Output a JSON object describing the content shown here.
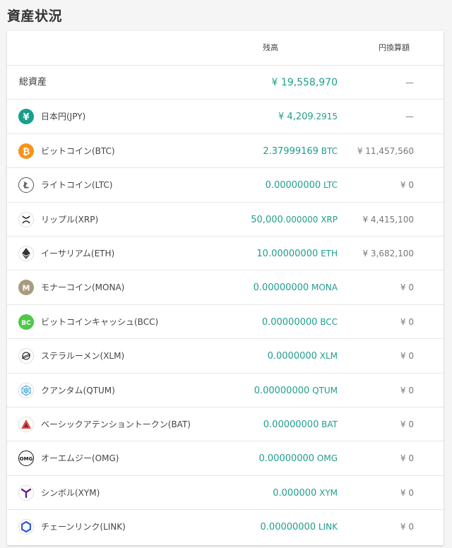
{
  "page": {
    "title": "資産状況"
  },
  "table": {
    "headers": {
      "balance": "残高",
      "jpy_value": "円換算額"
    },
    "total": {
      "label": "総資産",
      "balance_main": "¥ 19,558,970",
      "balance_sub": "",
      "jpy": "—"
    },
    "rows": [
      {
        "icon": "yen-icon",
        "color": "#1a9e8d",
        "name": "日本円(JPY)",
        "balance_main": "¥ 4,209",
        "balance_sub": ".2915",
        "jpy": "—"
      },
      {
        "icon": "bitcoin-icon",
        "color": "#f7931a",
        "name": "ビットコイン(BTC)",
        "balance_main": "2.37999169",
        "balance_sub": " BTC",
        "jpy": "¥ 11,457,560"
      },
      {
        "icon": "litecoin-icon",
        "color": "#555555",
        "name": "ライトコイン(LTC)",
        "balance_main": "0.00000000",
        "balance_sub": " LTC",
        "jpy": "¥ 0"
      },
      {
        "icon": "ripple-icon",
        "color": "#222222",
        "name": "リップル(XRP)",
        "balance_main": "50,000",
        "balance_sub": ".000000 XRP",
        "jpy": "¥ 4,415,100"
      },
      {
        "icon": "ethereum-icon",
        "color": "#333333",
        "name": "イーサリアム(ETH)",
        "balance_main": "10.00000000",
        "balance_sub": " ETH",
        "jpy": "¥ 3,682,100"
      },
      {
        "icon": "monacoin-icon",
        "color": "#a99b7e",
        "name": "モナーコイン(MONA)",
        "balance_main": "0.00000000",
        "balance_sub": " MONA",
        "jpy": "¥ 0"
      },
      {
        "icon": "bitcoin-cash-icon",
        "color": "#4cc947",
        "name": "ビットコインキャッシュ(BCC)",
        "balance_main": "0.00000000",
        "balance_sub": " BCC",
        "jpy": "¥ 0"
      },
      {
        "icon": "stellar-icon",
        "color": "#333333",
        "name": "ステラルーメン(XLM)",
        "balance_main": "0.0000000",
        "balance_sub": " XLM",
        "jpy": "¥ 0"
      },
      {
        "icon": "qtum-icon",
        "color": "#2e9ad0",
        "name": "クアンタム(QTUM)",
        "balance_main": "0.00000000",
        "balance_sub": " QTUM",
        "jpy": "¥ 0"
      },
      {
        "icon": "bat-icon",
        "color": "#e5483a",
        "name": "ベーシックアテンショントークン(BAT)",
        "balance_main": "0.00000000",
        "balance_sub": " BAT",
        "jpy": "¥ 0"
      },
      {
        "icon": "omg-icon",
        "color": "#111111",
        "name": "オーエムジー(OMG)",
        "balance_main": "0.00000000",
        "balance_sub": " OMG",
        "jpy": "¥ 0"
      },
      {
        "icon": "symbol-icon",
        "color": "#6a1b8a",
        "name": "シンボル(XYM)",
        "balance_main": "0.000000",
        "balance_sub": " XYM",
        "jpy": "¥ 0"
      },
      {
        "icon": "chainlink-icon",
        "color": "#2a5ada",
        "name": "チェーンリンク(LINK)",
        "balance_main": "0.00000000",
        "balance_sub": " LINK",
        "jpy": "¥ 0"
      }
    ]
  },
  "colors": {
    "accent": "#1f9d8d",
    "muted": "#777777",
    "border": "#e6e6e6"
  }
}
